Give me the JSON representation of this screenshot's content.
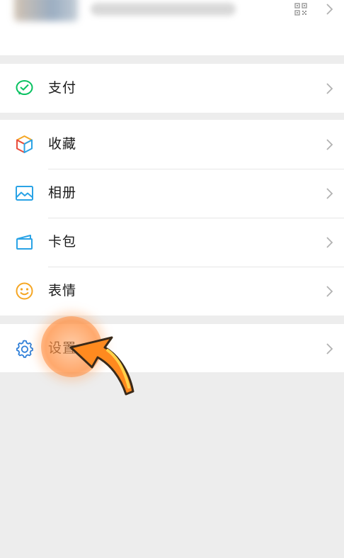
{
  "menu": {
    "pay": {
      "label": "支付",
      "icon": "wechat-pay-icon",
      "color": "#07c160"
    },
    "favorites": {
      "label": "收藏",
      "icon": "cube-icon"
    },
    "album": {
      "label": "相册",
      "icon": "photo-icon",
      "color": "#2aa3e6"
    },
    "cards": {
      "label": "卡包",
      "icon": "card-wallet-icon",
      "color": "#2aa3e6"
    },
    "stickers": {
      "label": "表情",
      "icon": "smiley-icon",
      "color": "#f5a623"
    },
    "settings": {
      "label": "设置",
      "icon": "gear-icon",
      "color": "#2f7fd8"
    }
  },
  "colors": {
    "background": "#ededed",
    "panel": "#ffffff",
    "tap_highlight": "#ff8a3d"
  }
}
